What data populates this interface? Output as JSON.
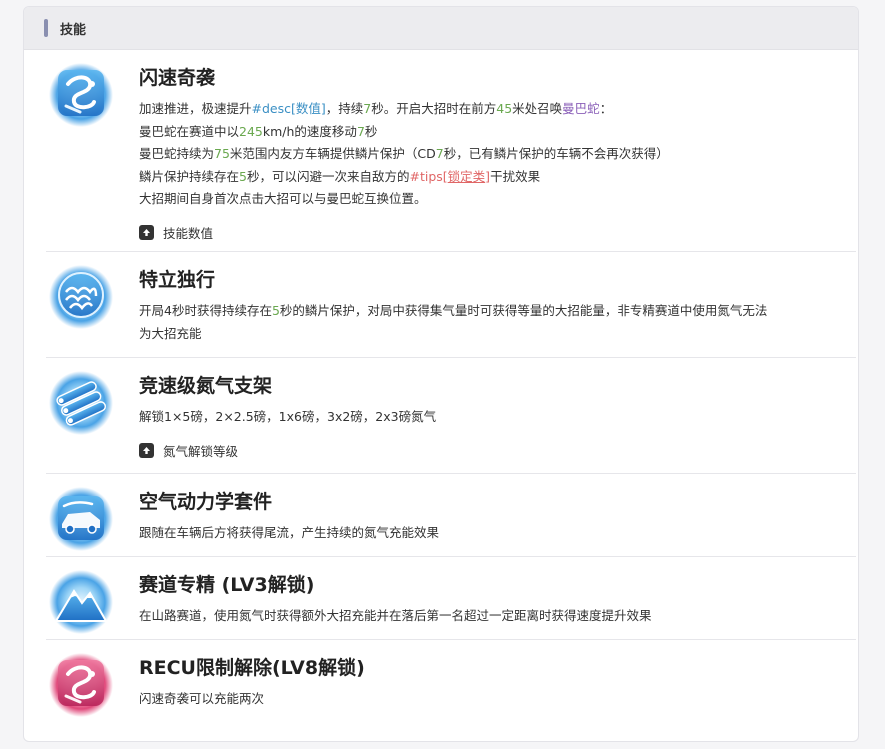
{
  "panel": {
    "title": "技能"
  },
  "skills": [
    {
      "name": "闪速奇袭",
      "desc": {
        "l1a": "加速推进，极速提升",
        "l1b": "#desc[数值]",
        "l1c": "，持续",
        "l1d": "7",
        "l1e": "秒。开启大招时在前方",
        "l1f": "45",
        "l1g": "米处召唤",
        "l1h": "曼巴蛇",
        "l1i": "：",
        "l2a": "曼巴蛇在赛道中以",
        "l2b": "245",
        "l2c": "km/h的速度移动",
        "l2d": "7",
        "l2e": "秒",
        "l3a": "曼巴蛇持续为",
        "l3b": "75",
        "l3c": "米范围内友方车辆提供鳞片保护（CD",
        "l3d": "7",
        "l3e": "秒，已有鳞片保护的车辆不会再次获得）",
        "l4a": "鳞片保护持续存在",
        "l4b": "5",
        "l4c": "秒，可以闪避一次来自敌方的",
        "l4d": "#tips[",
        "l4e": "锁定类",
        "l4f": "]",
        "l4g": "干扰效果",
        "l5": "大招期间自身首次点击大招可以与曼巴蛇互换位置。"
      },
      "expand_label": "技能数值"
    },
    {
      "name": "特立独行",
      "desc": {
        "l1a": "开局4秒时获得持续存在",
        "l1b": "5",
        "l1c": "秒的鳞片保护，对局中获得集气量时可获得等量的大招能量，非专精赛道中使用氮气无法",
        "l2": "为大招充能"
      }
    },
    {
      "name": "竞速级氮气支架",
      "desc": {
        "l1": "解锁1×5磅，2×2.5磅，1x6磅，3x2磅，2x3磅氮气"
      },
      "expand_label": "氮气解锁等级"
    },
    {
      "name": "空气动力学套件",
      "desc": {
        "l1": "跟随在车辆后方将获得尾流，产生持续的氮气充能效果"
      }
    },
    {
      "name": "赛道专精 (LV3解锁)",
      "desc": {
        "l1": "在山路赛道，使用氮气时获得额外大招充能并在落后第一名超过一定距离时获得速度提升效果"
      }
    },
    {
      "name": "RECU限制解除(LV8解锁)",
      "desc": {
        "l1": "闪速奇袭可以充能两次"
      }
    }
  ],
  "colors": {
    "highlight_green": "#6aa84f",
    "highlight_blue": "#3a8fc4",
    "highlight_purple": "#8a5fb8",
    "highlight_red": "#e06666",
    "icon_blue": "#4aa3e6",
    "icon_pink": "#e0487a"
  },
  "icons": [
    "serpent-icon",
    "scaled-shield-icon",
    "nitro-tanks-icon",
    "aero-car-icon",
    "mountain-icon",
    "serpent-icon-pink"
  ]
}
